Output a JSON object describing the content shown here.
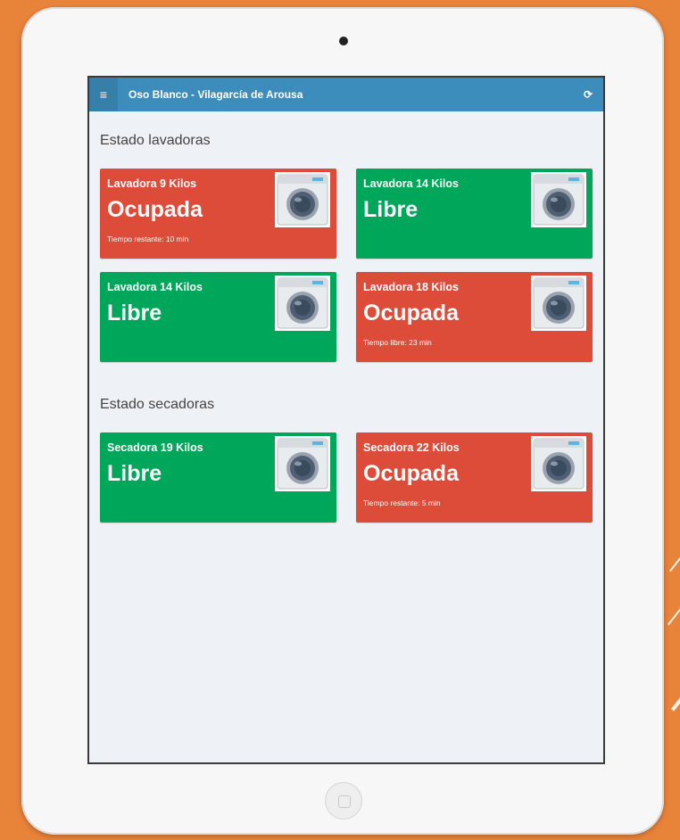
{
  "app": {
    "title": "Oso Blanco - Vilagarcía de Arousa",
    "menu_icon": "menu-icon",
    "refresh_icon": "refresh-icon"
  },
  "colors": {
    "background": "#E8833A",
    "header": "#3c8dbc",
    "busy": "#dd4b39",
    "free": "#00a65a"
  },
  "sections": {
    "washers_title": "Estado lavadoras",
    "dryers_title": "Estado secadoras"
  },
  "washers": [
    {
      "name": "Lavadora 9 Kilos",
      "status": "Ocupada",
      "time": "Tiempo restante: 10 min",
      "icon": "washing-machine-icon"
    },
    {
      "name": "Lavadora 14 Kilos",
      "status": "Libre",
      "time": "",
      "icon": "washing-machine-icon"
    },
    {
      "name": "Lavadora 14 Kilos",
      "status": "Libre",
      "time": "",
      "icon": "washing-machine-icon"
    },
    {
      "name": "Lavadora 18 Kilos",
      "status": "Ocupada",
      "time": "Tiempo libre: 23 min",
      "icon": "washing-machine-icon"
    }
  ],
  "dryers": [
    {
      "name": "Secadora 19 Kilos",
      "status": "Libre",
      "time": "",
      "icon": "washing-machine-icon"
    },
    {
      "name": "Secadora 22 Kilos",
      "status": "Ocupada",
      "time": "Tiempo restante: 5 min",
      "icon": "washing-machine-icon"
    }
  ]
}
